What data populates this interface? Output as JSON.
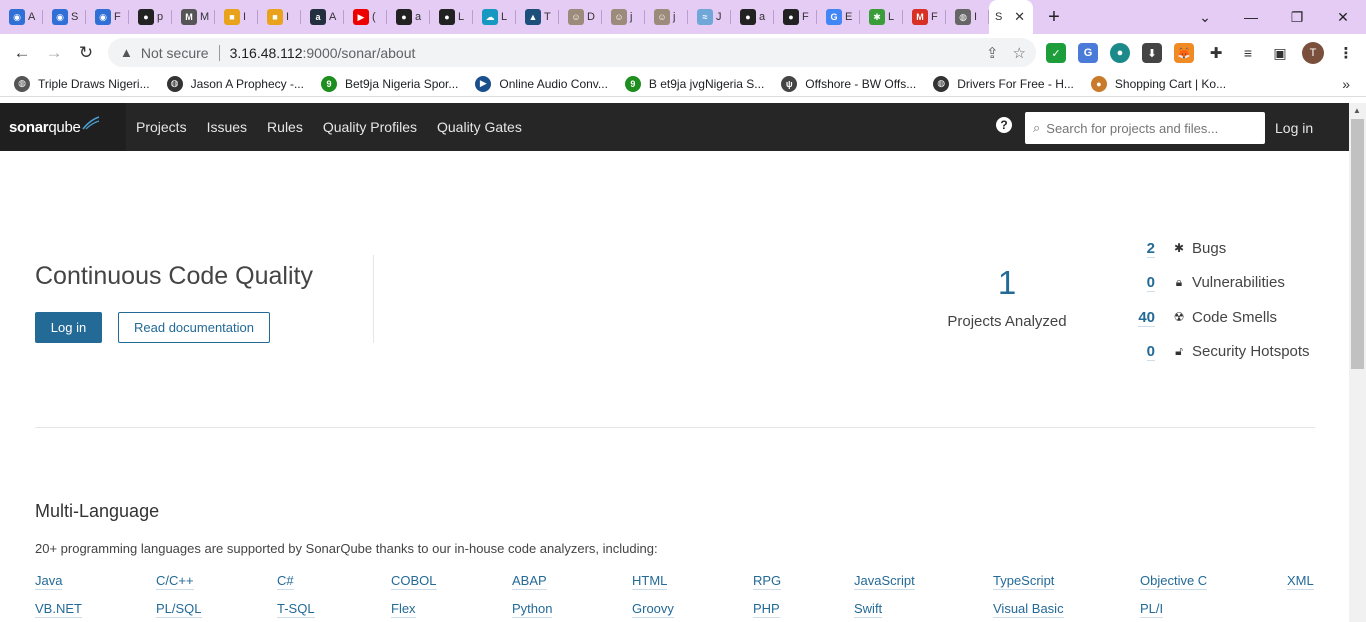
{
  "browser": {
    "tabs": [
      {
        "letter": "A",
        "icon": "firefox-like-icon"
      },
      {
        "letter": "S",
        "icon": "firefox-like-icon"
      },
      {
        "letter": "F",
        "icon": "firefox-like-icon"
      },
      {
        "letter": "p",
        "icon": "github-icon"
      },
      {
        "letter": "M",
        "icon": "markdown-icon"
      },
      {
        "letter": "I",
        "icon": "box-icon"
      },
      {
        "letter": "I",
        "icon": "box-icon"
      },
      {
        "letter": "A",
        "icon": "aws-icon"
      },
      {
        "letter": "(",
        "icon": "youtube-icon"
      },
      {
        "letter": "a",
        "icon": "github-icon"
      },
      {
        "letter": "L",
        "icon": "github-icon"
      },
      {
        "letter": "L",
        "icon": "cloud-icon"
      },
      {
        "letter": "T",
        "icon": "triangle-icon"
      },
      {
        "letter": "D",
        "icon": "avatar-icon"
      },
      {
        "letter": "j",
        "icon": "avatar-icon"
      },
      {
        "letter": "j",
        "icon": "avatar-icon"
      },
      {
        "letter": "J",
        "icon": "wave-icon"
      },
      {
        "letter": "a",
        "icon": "github-icon"
      },
      {
        "letter": "F",
        "icon": "github-icon"
      },
      {
        "letter": "E",
        "icon": "google-icon"
      },
      {
        "letter": "L",
        "icon": "bug-icon"
      },
      {
        "letter": "F",
        "icon": "gmail-icon"
      },
      {
        "letter": "I",
        "icon": "globe-icon"
      }
    ],
    "active_tab": {
      "letter": "S"
    },
    "new_tab_symbol": "+",
    "not_secure": "Not secure",
    "url_host": "3.16.48.112",
    "url_path": ":9000/sonar/about",
    "avatar_letter": "T"
  },
  "bookmarks": [
    {
      "label": "Triple Draws Nigeri...",
      "icon": "globe-icon",
      "color": "#555555"
    },
    {
      "label": "Jason A Prophecy -...",
      "icon": "globe-icon",
      "color": "#333333"
    },
    {
      "label": "Bet9ja Nigeria Spor...",
      "icon": "bet9ja-icon",
      "color": "#1e8f1e"
    },
    {
      "label": "Online Audio Conv...",
      "icon": "play-icon",
      "color": "#1a4f8b"
    },
    {
      "label": "B et9ja jvgNigeria S...",
      "icon": "bet9ja-icon",
      "color": "#1e8f1e"
    },
    {
      "label": "Offshore - BW Offs...",
      "icon": "signal-icon",
      "color": "#444444"
    },
    {
      "label": "Drivers For Free - H...",
      "icon": "globe-icon",
      "color": "#333333"
    },
    {
      "label": "Shopping Cart | Ko...",
      "icon": "cart-icon",
      "color": "#c97a2a"
    }
  ],
  "sonar": {
    "logo_a": "sonar",
    "logo_b": "qube",
    "nav": [
      "Projects",
      "Issues",
      "Rules",
      "Quality Profiles",
      "Quality Gates"
    ],
    "help": "?",
    "search_placeholder": "Search for projects and files...",
    "login": "Log in"
  },
  "hero": {
    "title": "Continuous Code Quality",
    "login_button": "Log in",
    "docs_button": "Read documentation",
    "projects_count": "1",
    "projects_label": "Projects Analyzed",
    "metrics": [
      {
        "value": "2",
        "label": "Bugs",
        "icon": "bug-icon"
      },
      {
        "value": "0",
        "label": "Vulnerabilities",
        "icon": "lock-icon"
      },
      {
        "value": "40",
        "label": "Code Smells",
        "icon": "radiation-icon"
      },
      {
        "value": "0",
        "label": "Security Hotspots",
        "icon": "lock-icon"
      }
    ]
  },
  "multi_language": {
    "title": "Multi-Language",
    "description": "20+ programming languages are supported by SonarQube thanks to our in-house code analyzers, including:",
    "row1": [
      "Java",
      "C/C++",
      "C#",
      "COBOL",
      "ABAP",
      "HTML",
      "RPG",
      "JavaScript",
      "TypeScript",
      "Objective C",
      "XML"
    ],
    "row2": [
      "VB.NET",
      "PL/SQL",
      "T-SQL",
      "Flex",
      "Python",
      "Groovy",
      "PHP",
      "Swift",
      "Visual Basic",
      "PL/I"
    ]
  },
  "colors": {
    "tab_strip": "#e5ccf5",
    "sonar_nav": "#262626",
    "accent": "#236a97"
  }
}
